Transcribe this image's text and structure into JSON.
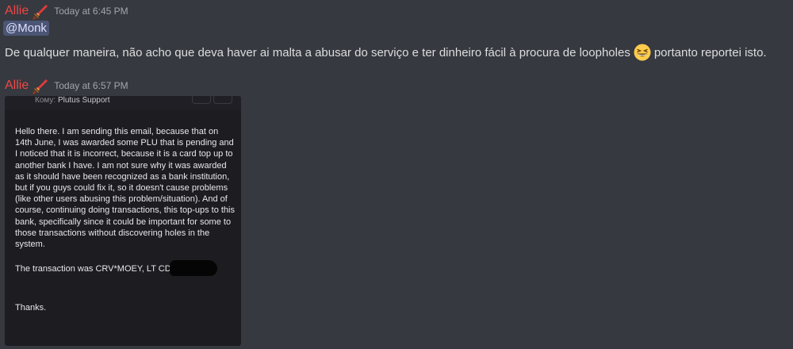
{
  "messages": [
    {
      "author": "Allie",
      "timestamp": "Today at 6:45 PM",
      "mention": "@Monk",
      "text_before_emoji": "De qualquer maneira, não acho que deva haver ai malta a abusar do serviço e ter dinheiro fácil à procura de loopholes",
      "emoji": "grinning-squinting-face",
      "text_after_emoji": "portanto reportei isto."
    },
    {
      "author": "Allie",
      "timestamp": "Today at 6:57 PM",
      "attachment": {
        "to_label": "Кому:",
        "to_value": "Plutus Support",
        "paragraph1": "Hello there. I am sending this email, because that on 14th June, I was awarded some PLU that is pending and I noticed that it is incorrect, because it is a card top up to another bank I have. I am not sure why it was awarded as it should have been recognized as a bank institution, but if you guys could fix it, so it doesn't cause problems (like other users abusing this problem/situation). And of course, continuing doing transactions, this top-ups to this bank, specifically since it could be important for some to those transactions without discovering holes in the system.",
        "paragraph2": "The transaction was CRV*MOEY, LT CD",
        "paragraph3": "Thanks."
      }
    }
  ],
  "colors": {
    "background": "#36393f",
    "author": "#f04747",
    "timestamp": "#a3a6aa",
    "text": "#dcddde",
    "mention_bg": "#5865a0"
  },
  "icons": {
    "role_icon": "sword-icon"
  }
}
